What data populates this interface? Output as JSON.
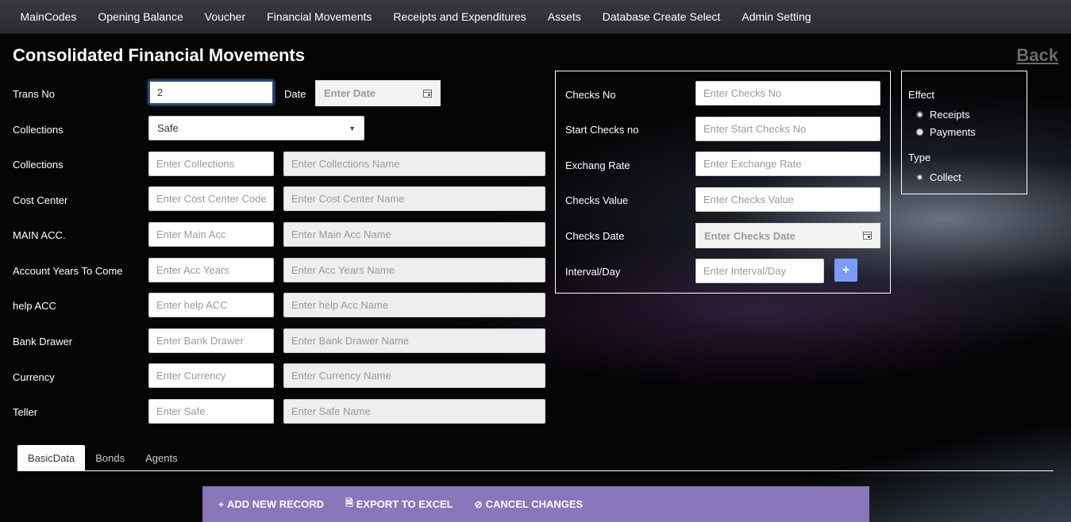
{
  "nav": {
    "items": [
      "MainCodes",
      "Opening Balance",
      "Voucher",
      "Financial Movements",
      "Receipts and Expenditures",
      "Assets",
      "Database Create Select",
      "Admin Setting"
    ]
  },
  "page": {
    "title": "Consolidated Financial Movements",
    "back": "Back"
  },
  "form": {
    "trans_no": {
      "label": "Trans No",
      "value": "2"
    },
    "date": {
      "label": "Date",
      "placeholder": "Enter Date"
    },
    "collections_select": {
      "label": "Collections",
      "value": "Safe"
    },
    "collections": {
      "label": "Collections",
      "code_ph": "Enter Collections",
      "name_ph": "Enter Collections Name"
    },
    "cost_center": {
      "label": "Cost Center",
      "code_ph": "Enter Cost Center Code",
      "name_ph": "Enter Cost Center Name"
    },
    "main_acc": {
      "label": "MAIN ACC.",
      "code_ph": "Enter Main Acc",
      "name_ph": "Enter Main Acc Name"
    },
    "acc_years": {
      "label": "Account Years To Come",
      "code_ph": "Enter Acc Years",
      "name_ph": "Enter Acc Years Name"
    },
    "help_acc": {
      "label": "help ACC",
      "code_ph": "Enter help ACC",
      "name_ph": "Enter help Acc Name"
    },
    "bank_drawer": {
      "label": "Bank Drawer",
      "code_ph": "Enter Bank Drawer",
      "name_ph": "Enter Bank Drawer Name"
    },
    "currency": {
      "label": "Currency",
      "code_ph": "Enter Currency",
      "name_ph": "Enter Currency Name"
    },
    "teller": {
      "label": "Teller",
      "code_ph": "Enter Safe",
      "name_ph": "Enter Safe Name"
    }
  },
  "checks": {
    "checks_no": {
      "label": "Checks No",
      "placeholder": "Enter Checks No"
    },
    "start_checks": {
      "label": "Start Checks no",
      "placeholder": "Enter Start Checks No"
    },
    "exchange_rate": {
      "label": "Exchang Rate",
      "placeholder": "Enter Exchange Rate"
    },
    "checks_value": {
      "label": "Checks Value",
      "placeholder": "Enter Checks Value"
    },
    "checks_date": {
      "label": "Checks Date",
      "placeholder": "Enter Checks Date"
    },
    "interval": {
      "label": "Interval/Day",
      "placeholder": "Enter Interval/Day"
    },
    "plus": "+"
  },
  "effect": {
    "label": "Effect",
    "options": [
      "Receipts",
      "Payments"
    ],
    "type_label": "Type",
    "type_options": [
      "Collect"
    ]
  },
  "tabs": [
    "BasicData",
    "Bonds",
    "Agents"
  ],
  "toolbar": {
    "add": "ADD NEW RECORD",
    "export": "EXPORT TO EXCEL",
    "cancel": "CANCEL CHANGES"
  }
}
